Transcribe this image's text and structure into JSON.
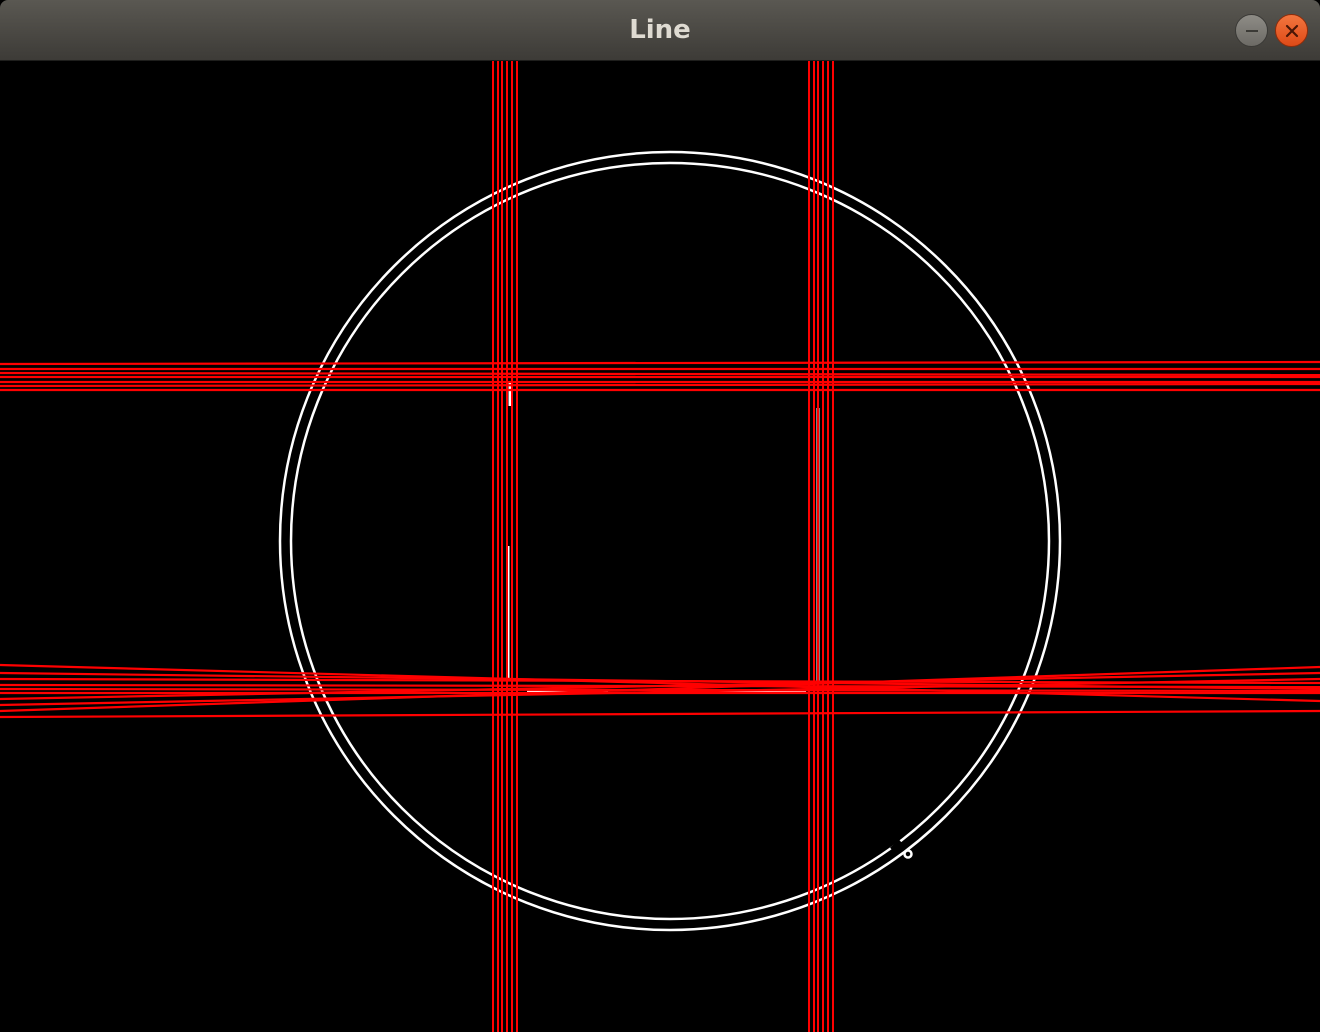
{
  "window": {
    "title": "Line",
    "controls": {
      "minimize_icon": "minimize-icon",
      "close_icon": "close-icon"
    }
  },
  "canvas": {
    "background": "#000000",
    "line_color": "#ff0000",
    "edge_color": "#ffffff"
  }
}
